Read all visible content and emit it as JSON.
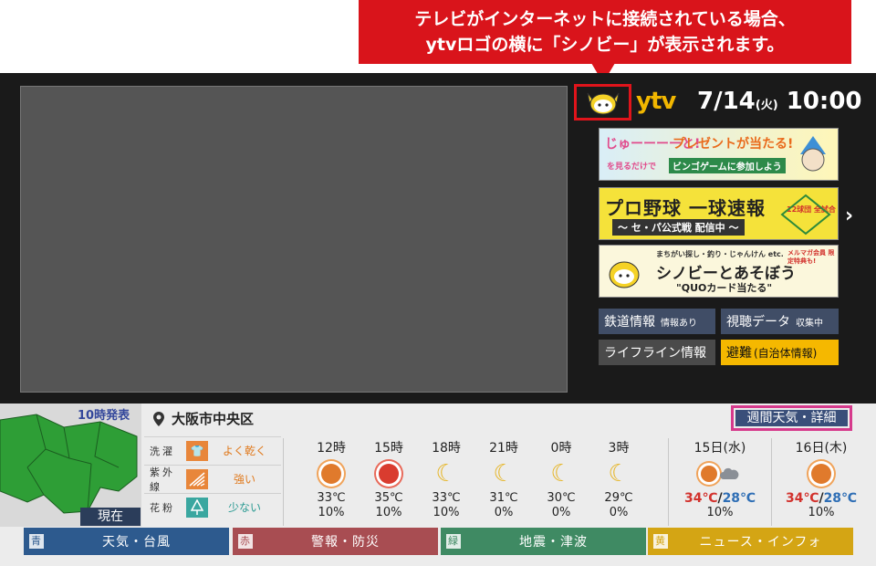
{
  "callout": {
    "line1": "テレビがインターネットに接続されている場合、",
    "line2": "ytvロゴの横に「シノビー」が表示されます。"
  },
  "header": {
    "logo": "ytv",
    "date": "7/14",
    "dow": "(火)",
    "time": "10:00"
  },
  "banners": [
    {
      "text_a": "じゅーーーーと!",
      "text_b": "プレゼントが当たる!",
      "text_c": "ビンゴゲームに参加しよう",
      "text_d": "を見るだけで"
    },
    {
      "text_a": "プロ野球 一球速報",
      "text_b": "〜 セ・パ公式戦 配信中 〜",
      "text_c": "12球団 全試合"
    },
    {
      "text_a": "まちがい探し・釣り・じゃんけん etc.",
      "text_b": "シノビーとあそぼう",
      "text_c": "\"QUOカード当たる\"",
      "text_d": "メルマガ会員 限定特典も!"
    }
  ],
  "info_buttons": [
    {
      "label": "鉄道情報",
      "sub": "情報あり"
    },
    {
      "label": "視聴データ",
      "sub": "収集中"
    },
    {
      "label": "ライフライン情報",
      "sub": ""
    },
    {
      "label": "避難",
      "sub": "(自治体情報)"
    }
  ],
  "weather": {
    "release": "10時発表",
    "now_label": "現在",
    "location": "大阪市中央区",
    "weekly_button": "週間天気・詳細",
    "indices": [
      {
        "label": "洗濯",
        "value": "よく乾く",
        "icon": "shirt-icon",
        "color": "#e8863a",
        "value_color": "#e07a1e"
      },
      {
        "label": "紫外線",
        "value": "強い",
        "icon": "uv-icon",
        "color": "#e8863a",
        "value_color": "#e07a1e"
      },
      {
        "label": "花粉",
        "value": "少ない",
        "icon": "tree-icon",
        "color": "#3aa7a0",
        "value_color": "#2a9a92"
      }
    ],
    "hourly": [
      {
        "time": "12時",
        "icon": "sun",
        "temp": "33℃",
        "pop": "10%"
      },
      {
        "time": "15時",
        "icon": "sun-red",
        "temp": "35℃",
        "pop": "10%"
      },
      {
        "time": "18時",
        "icon": "moon",
        "temp": "33℃",
        "pop": "10%"
      },
      {
        "time": "21時",
        "icon": "moon",
        "temp": "31℃",
        "pop": "0%"
      },
      {
        "time": "0時",
        "icon": "moon",
        "temp": "30℃",
        "pop": "0%"
      },
      {
        "time": "3時",
        "icon": "moon",
        "temp": "29℃",
        "pop": "0%"
      }
    ],
    "daily": [
      {
        "date": "15日(水)",
        "icon": "sun-cloud",
        "hi": "34℃",
        "sep": "/",
        "lo": "28℃",
        "pop": "10%"
      },
      {
        "date": "16日(木)",
        "icon": "sun",
        "hi": "34℃",
        "sep": "/",
        "lo": "28℃",
        "pop": "10%"
      }
    ]
  },
  "color_buttons": [
    {
      "key": "青",
      "label": "天気・台風",
      "color": "#2d5a8e"
    },
    {
      "key": "赤",
      "label": "警報・防災",
      "color": "#a84d52"
    },
    {
      "key": "緑",
      "label": "地震・津波",
      "color": "#3f8a63"
    },
    {
      "key": "黄",
      "label": "ニュース・インフォ",
      "color": "#d4a514"
    }
  ]
}
